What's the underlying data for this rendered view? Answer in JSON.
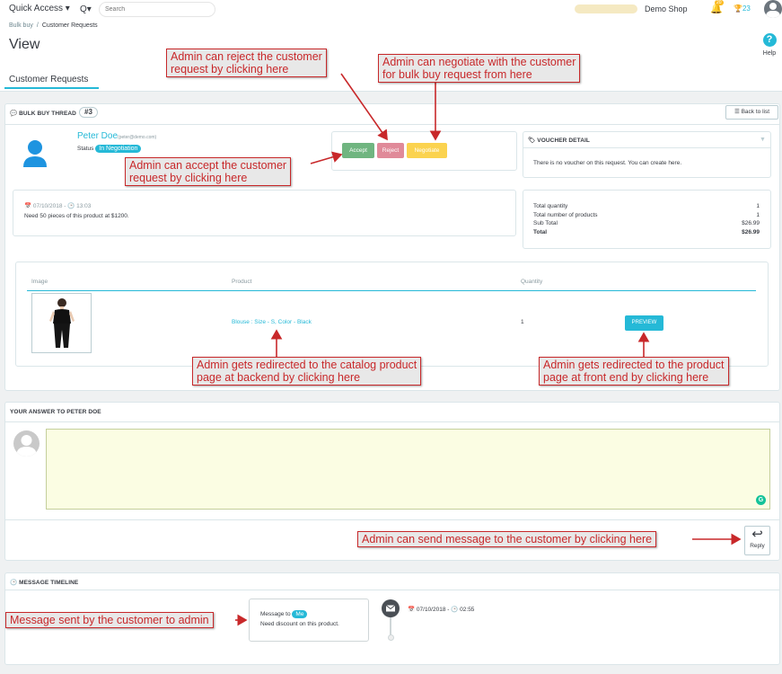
{
  "topbar": {
    "quick_access": "Quick Access ▾",
    "search_icon": "Q▾",
    "search_placeholder": "Search",
    "shop_name": "Demo Shop",
    "bell_badge": "20",
    "trophy_count": "23"
  },
  "breadcrumb": {
    "parent": "Bulk buy",
    "separator": "/",
    "current": "Customer Requests"
  },
  "page_title": "View",
  "help_label": "Help",
  "help_icon": "?",
  "tab_label": "Customer Requests",
  "thread": {
    "header": "BULK BUY THREAD",
    "number": "#3",
    "back_label": "Back to list",
    "customer_name": "Peter Doe",
    "customer_email": "(peter@demo.com)",
    "status_label": "Status",
    "status_value": "In Negotiation",
    "accept_label": "Accept",
    "reject_label": "Reject",
    "negotiate_label": "Negotiate",
    "date": "07/10/2018",
    "time": "13:03",
    "note": "Need 50 pieces of this product at $1200."
  },
  "voucher": {
    "header": "VOUCHER DETAIL",
    "text": "There is no voucher on this request. You can create here."
  },
  "totals": [
    {
      "label": "Total quantity",
      "value": "1",
      "bold": false
    },
    {
      "label": "Total number of products",
      "value": "1",
      "bold": false
    },
    {
      "label": "Sub Total",
      "value": "$26.99",
      "bold": false
    },
    {
      "label": "Total",
      "value": "$26.99",
      "bold": true
    }
  ],
  "product_table": {
    "headers": [
      "Image",
      "Product",
      "Quantity"
    ],
    "row": {
      "product": "Blouse : Size - S, Color - Black",
      "quantity": "1",
      "preview_label": "PREVIEW"
    }
  },
  "answer": {
    "header": "YOUR ANSWER TO PETER DOE",
    "reply_label": "Reply",
    "reply_icon": "↩",
    "grammarly_icon": "G"
  },
  "timeline": {
    "header": "MESSAGE TIMELINE",
    "message_to": "Message to",
    "recipient": "Me",
    "message": "Need discount on this product.",
    "date": "07/10/2018",
    "dash": "-",
    "time": "02:55"
  },
  "annotations": {
    "reject": [
      "Admin can reject the customer",
      "request by clicking here"
    ],
    "negotiate": [
      "Admin can negotiate with the customer",
      "for bulk buy request from here"
    ],
    "accept": [
      "Admin can accept the customer",
      "request by clicking here"
    ],
    "catalog": [
      "Admin gets redirected to the catalog product",
      "page at backend by clicking here"
    ],
    "front": [
      "Admin gets redirected to the product",
      "page at front end by clicking here"
    ],
    "send": [
      "Admin can send message to the customer by clicking here"
    ],
    "sent": [
      "Message sent by the customer to admin"
    ]
  },
  "colors": {
    "accent": "#25b9d7",
    "accept": "#70b580",
    "reject": "#e08a99",
    "negotiate": "#fbd34f",
    "annotation_border": "#c8282a",
    "textarea_bg": "#fbfde3"
  }
}
